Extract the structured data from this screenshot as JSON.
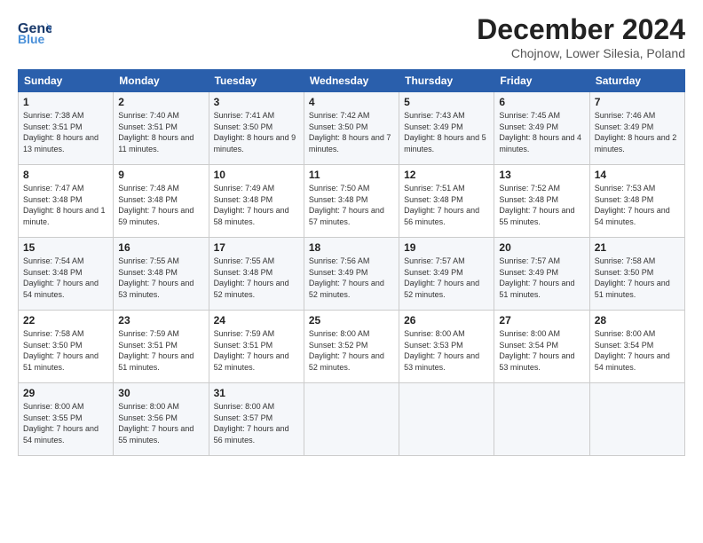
{
  "header": {
    "logo_general": "General",
    "logo_blue": "Blue",
    "month_title": "December 2024",
    "subtitle": "Chojnow, Lower Silesia, Poland"
  },
  "days_of_week": [
    "Sunday",
    "Monday",
    "Tuesday",
    "Wednesday",
    "Thursday",
    "Friday",
    "Saturday"
  ],
  "weeks": [
    [
      {
        "day": "1",
        "sunrise": "7:38 AM",
        "sunset": "3:51 PM",
        "daylight": "8 hours and 13 minutes."
      },
      {
        "day": "2",
        "sunrise": "7:40 AM",
        "sunset": "3:51 PM",
        "daylight": "8 hours and 11 minutes."
      },
      {
        "day": "3",
        "sunrise": "7:41 AM",
        "sunset": "3:50 PM",
        "daylight": "8 hours and 9 minutes."
      },
      {
        "day": "4",
        "sunrise": "7:42 AM",
        "sunset": "3:50 PM",
        "daylight": "8 hours and 7 minutes."
      },
      {
        "day": "5",
        "sunrise": "7:43 AM",
        "sunset": "3:49 PM",
        "daylight": "8 hours and 5 minutes."
      },
      {
        "day": "6",
        "sunrise": "7:45 AM",
        "sunset": "3:49 PM",
        "daylight": "8 hours and 4 minutes."
      },
      {
        "day": "7",
        "sunrise": "7:46 AM",
        "sunset": "3:49 PM",
        "daylight": "8 hours and 2 minutes."
      }
    ],
    [
      {
        "day": "8",
        "sunrise": "7:47 AM",
        "sunset": "3:48 PM",
        "daylight": "8 hours and 1 minute."
      },
      {
        "day": "9",
        "sunrise": "7:48 AM",
        "sunset": "3:48 PM",
        "daylight": "7 hours and 59 minutes."
      },
      {
        "day": "10",
        "sunrise": "7:49 AM",
        "sunset": "3:48 PM",
        "daylight": "7 hours and 58 minutes."
      },
      {
        "day": "11",
        "sunrise": "7:50 AM",
        "sunset": "3:48 PM",
        "daylight": "7 hours and 57 minutes."
      },
      {
        "day": "12",
        "sunrise": "7:51 AM",
        "sunset": "3:48 PM",
        "daylight": "7 hours and 56 minutes."
      },
      {
        "day": "13",
        "sunrise": "7:52 AM",
        "sunset": "3:48 PM",
        "daylight": "7 hours and 55 minutes."
      },
      {
        "day": "14",
        "sunrise": "7:53 AM",
        "sunset": "3:48 PM",
        "daylight": "7 hours and 54 minutes."
      }
    ],
    [
      {
        "day": "15",
        "sunrise": "7:54 AM",
        "sunset": "3:48 PM",
        "daylight": "7 hours and 54 minutes."
      },
      {
        "day": "16",
        "sunrise": "7:55 AM",
        "sunset": "3:48 PM",
        "daylight": "7 hours and 53 minutes."
      },
      {
        "day": "17",
        "sunrise": "7:55 AM",
        "sunset": "3:48 PM",
        "daylight": "7 hours and 52 minutes."
      },
      {
        "day": "18",
        "sunrise": "7:56 AM",
        "sunset": "3:49 PM",
        "daylight": "7 hours and 52 minutes."
      },
      {
        "day": "19",
        "sunrise": "7:57 AM",
        "sunset": "3:49 PM",
        "daylight": "7 hours and 52 minutes."
      },
      {
        "day": "20",
        "sunrise": "7:57 AM",
        "sunset": "3:49 PM",
        "daylight": "7 hours and 51 minutes."
      },
      {
        "day": "21",
        "sunrise": "7:58 AM",
        "sunset": "3:50 PM",
        "daylight": "7 hours and 51 minutes."
      }
    ],
    [
      {
        "day": "22",
        "sunrise": "7:58 AM",
        "sunset": "3:50 PM",
        "daylight": "7 hours and 51 minutes."
      },
      {
        "day": "23",
        "sunrise": "7:59 AM",
        "sunset": "3:51 PM",
        "daylight": "7 hours and 51 minutes."
      },
      {
        "day": "24",
        "sunrise": "7:59 AM",
        "sunset": "3:51 PM",
        "daylight": "7 hours and 52 minutes."
      },
      {
        "day": "25",
        "sunrise": "8:00 AM",
        "sunset": "3:52 PM",
        "daylight": "7 hours and 52 minutes."
      },
      {
        "day": "26",
        "sunrise": "8:00 AM",
        "sunset": "3:53 PM",
        "daylight": "7 hours and 53 minutes."
      },
      {
        "day": "27",
        "sunrise": "8:00 AM",
        "sunset": "3:54 PM",
        "daylight": "7 hours and 53 minutes."
      },
      {
        "day": "28",
        "sunrise": "8:00 AM",
        "sunset": "3:54 PM",
        "daylight": "7 hours and 54 minutes."
      }
    ],
    [
      {
        "day": "29",
        "sunrise": "8:00 AM",
        "sunset": "3:55 PM",
        "daylight": "7 hours and 54 minutes."
      },
      {
        "day": "30",
        "sunrise": "8:00 AM",
        "sunset": "3:56 PM",
        "daylight": "7 hours and 55 minutes."
      },
      {
        "day": "31",
        "sunrise": "8:00 AM",
        "sunset": "3:57 PM",
        "daylight": "7 hours and 56 minutes."
      },
      null,
      null,
      null,
      null
    ]
  ],
  "labels": {
    "sunrise": "Sunrise:",
    "sunset": "Sunset:",
    "daylight": "Daylight:"
  }
}
